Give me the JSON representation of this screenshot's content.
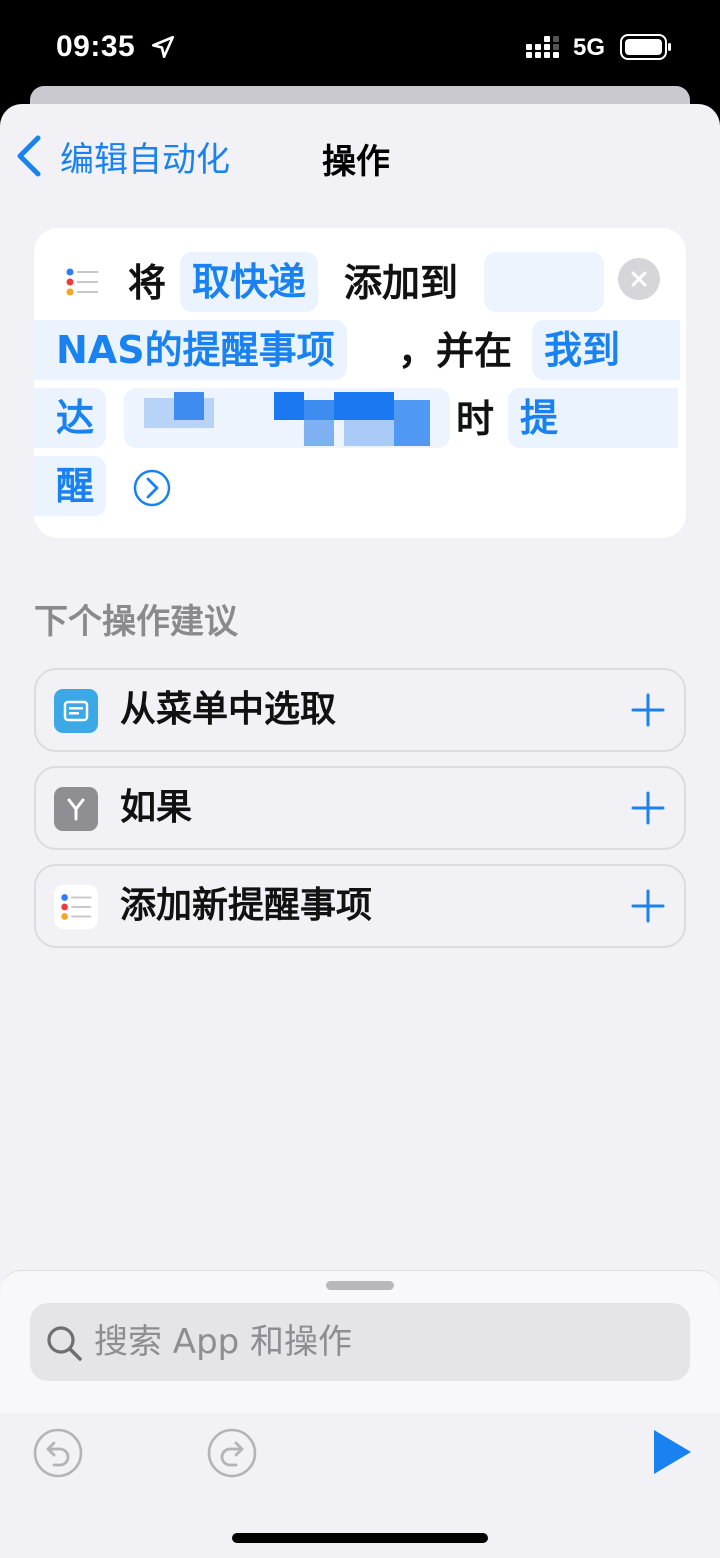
{
  "status_bar": {
    "time": "09:35",
    "network": "5G"
  },
  "nav": {
    "back_label": "编辑自动化",
    "title": "操作"
  },
  "action": {
    "word_1": "将",
    "item_token": "取快递",
    "word_2": "添加到",
    "list_token": "NAS的提醒事项",
    "word_3": "，并在",
    "trigger_token_line1": "我到",
    "trigger_token_line2": "达",
    "word_4": "时",
    "remind_token_line1": "提",
    "remind_token_line2": "醒"
  },
  "suggestions": {
    "title": "下个操作建议",
    "items": [
      {
        "label": "从菜单中选取"
      },
      {
        "label": "如果"
      },
      {
        "label": "添加新提醒事项"
      }
    ]
  },
  "search": {
    "placeholder": "搜索 App 和操作"
  },
  "colors": {
    "accent": "#1a82f0",
    "sheet_bg": "#f1f1f6",
    "token_bg": "#eaf3fe",
    "menu_icon": "#3da8e6",
    "if_icon": "#8e8e93"
  }
}
